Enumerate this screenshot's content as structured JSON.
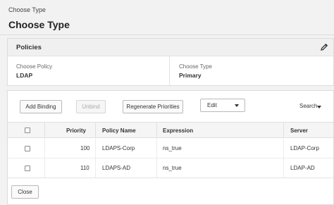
{
  "header": {
    "breadcrumb": "Choose Type",
    "title": "Choose Type"
  },
  "policies_panel": {
    "title": "Policies",
    "edit_icon": "pencil-icon",
    "choose_policy_label": "Choose Policy",
    "choose_policy_value": "LDAP",
    "choose_type_label": "Choose Type",
    "choose_type_value": "Primary"
  },
  "toolbar": {
    "add_binding": "Add Binding",
    "unbind": "Unbind",
    "regenerate": "Regenerate Priorities",
    "edit_select": "Edit",
    "search": "Search"
  },
  "table": {
    "columns": [
      "Priority",
      "Policy Name",
      "Expression",
      "Server"
    ],
    "rows": [
      {
        "priority": "100",
        "policy_name": "LDAPS-Corp",
        "expression": "ns_true",
        "server": "LDAP-Corp"
      },
      {
        "priority": "110",
        "policy_name": "LDAPS-AD",
        "expression": "ns_true",
        "server": "LDAP-AD"
      }
    ]
  },
  "footer": {
    "close": "Close"
  },
  "colors": {
    "background": "#f2f2f2",
    "panel": "#ffffff",
    "border": "#dcdcdc"
  }
}
